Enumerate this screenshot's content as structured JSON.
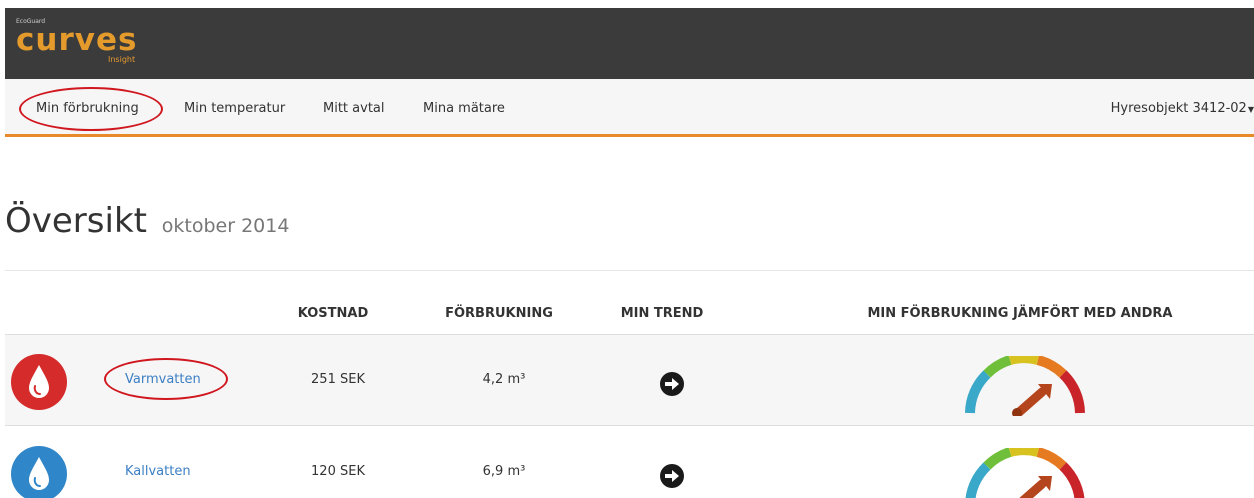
{
  "header": {
    "logo_small": "EcoGuard",
    "logo_main": "curves",
    "logo_sub": "Insight",
    "background": "#3b3b3b",
    "logo_color": "#e59a2c"
  },
  "nav": {
    "items": [
      {
        "label": "Min förbrukning"
      },
      {
        "label": "Min temperatur"
      },
      {
        "label": "Mitt avtal"
      },
      {
        "label": "Mina mätare"
      }
    ],
    "object_label": "Hyresobjekt 3412-02",
    "accent": "#e98a2a"
  },
  "page": {
    "title": "Översikt",
    "subtitle": "oktober 2014"
  },
  "table": {
    "headers": {
      "cost": "KOSTNAD",
      "consumption": "FÖRBRUKNING",
      "trend": "MIN TREND",
      "compare": "MIN FÖRBRUKNING JÄMFÖRT MED ANDRA"
    },
    "rows": [
      {
        "name": "Varmvatten",
        "cost": "251 SEK",
        "consumption": "4,2 m³",
        "icon": "drop-icon",
        "icon_color": "#d52b2b"
      },
      {
        "name": "Kallvatten",
        "cost": "120 SEK",
        "consumption": "6,9 m³",
        "icon": "drop-icon",
        "icon_color": "#2f86c9"
      }
    ]
  },
  "annotation_color": "#d0171f"
}
